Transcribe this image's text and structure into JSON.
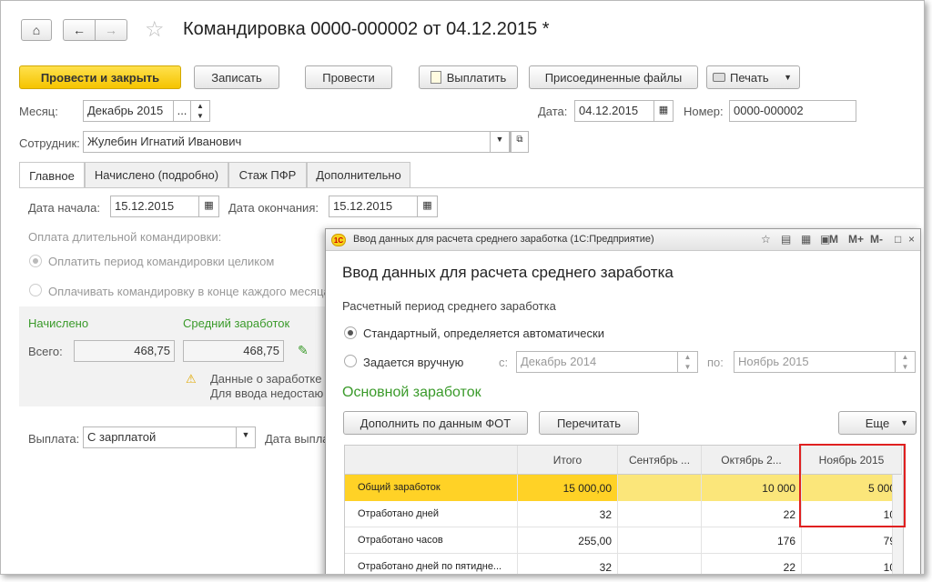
{
  "window": {
    "title": "Командировка 0000-000002 от 04.12.2015 *"
  },
  "nav": {
    "home_icon": "⌂",
    "back_icon": "←",
    "forward_icon": "→",
    "star_icon": "☆"
  },
  "toolbar": {
    "post_close": "Провести и закрыть",
    "save": "Записать",
    "post": "Провести",
    "pay": "Выплатить",
    "attached_files": "Присоединенные файлы",
    "print": "Печать"
  },
  "header": {
    "month_label": "Месяц:",
    "month_value": "Декабрь 2015",
    "date_label": "Дата:",
    "date_value": "04.12.2015",
    "number_label": "Номер:",
    "number_value": "0000-000002",
    "employee_label": "Сотрудник:",
    "employee_value": "Жулебин Игнатий Иванович"
  },
  "tabs": [
    {
      "label": "Главное"
    },
    {
      "label": "Начислено (подробно)"
    },
    {
      "label": "Стаж ПФР"
    },
    {
      "label": "Дополнительно"
    }
  ],
  "main": {
    "start_label": "Дата начала:",
    "start_value": "15.12.2015",
    "end_label": "Дата окончания:",
    "end_value": "15.12.2015",
    "long_trip_label": "Оплата длительной командировки:",
    "opt_full": "Оплатить период командировки целиком",
    "opt_end": "Оплачивать командировку в конце каждого месяца",
    "accrued_label": "Начислено",
    "avg_label": "Средний заработок",
    "total_label": "Всего:",
    "total_value": "468,75",
    "avg_value": "468,75",
    "warning_line1": "Данные о заработке к",
    "warning_line2": "Для ввода недостаю",
    "payout_label": "Выплата:",
    "payout_value": "С зарплатой",
    "payout_date_label": "Дата выпла"
  },
  "dialog": {
    "window_title": "Ввод данных для расчета среднего заработка  (1С:Предприятие)",
    "logo": "1C",
    "heading": "Ввод данных для расчета среднего заработка",
    "period_label": "Расчетный период среднего заработка",
    "opt_standard": "Стандартный, определяется автоматически",
    "opt_manual": "Задается вручную",
    "from_label": "с:",
    "from_value": "Декабрь 2014",
    "to_label": "по:",
    "to_value": "Ноябрь 2015",
    "section_title": "Основной заработок",
    "btn_fill": "Дополнить по данным ФОТ",
    "btn_reread": "Перечитать",
    "btn_more": "Еще",
    "tb_m": "M",
    "tb_mplus": "M+",
    "tb_mminus": "M-"
  },
  "table": {
    "columns": [
      "",
      "Итого",
      "Сентябрь ...",
      "Октябрь 2...",
      "Ноябрь 2015"
    ],
    "rows": [
      {
        "label": "Общий заработок",
        "total": "15 000,00",
        "sep": "",
        "oct": "10 000",
        "nov": "5 000"
      },
      {
        "label": "Отработано дней",
        "total": "32",
        "sep": "",
        "oct": "22",
        "nov": "10"
      },
      {
        "label": "Отработано часов",
        "total": "255,00",
        "sep": "",
        "oct": "176",
        "nov": "79"
      },
      {
        "label": "Отработано дней по пятидне...",
        "total": "32",
        "sep": "",
        "oct": "22",
        "nov": "10"
      }
    ]
  },
  "colors": {
    "accent_yellow": "#f5c400",
    "green": "#3a9a2a",
    "highlight_red": "#e02020",
    "row_selected": "#fbe67a"
  }
}
